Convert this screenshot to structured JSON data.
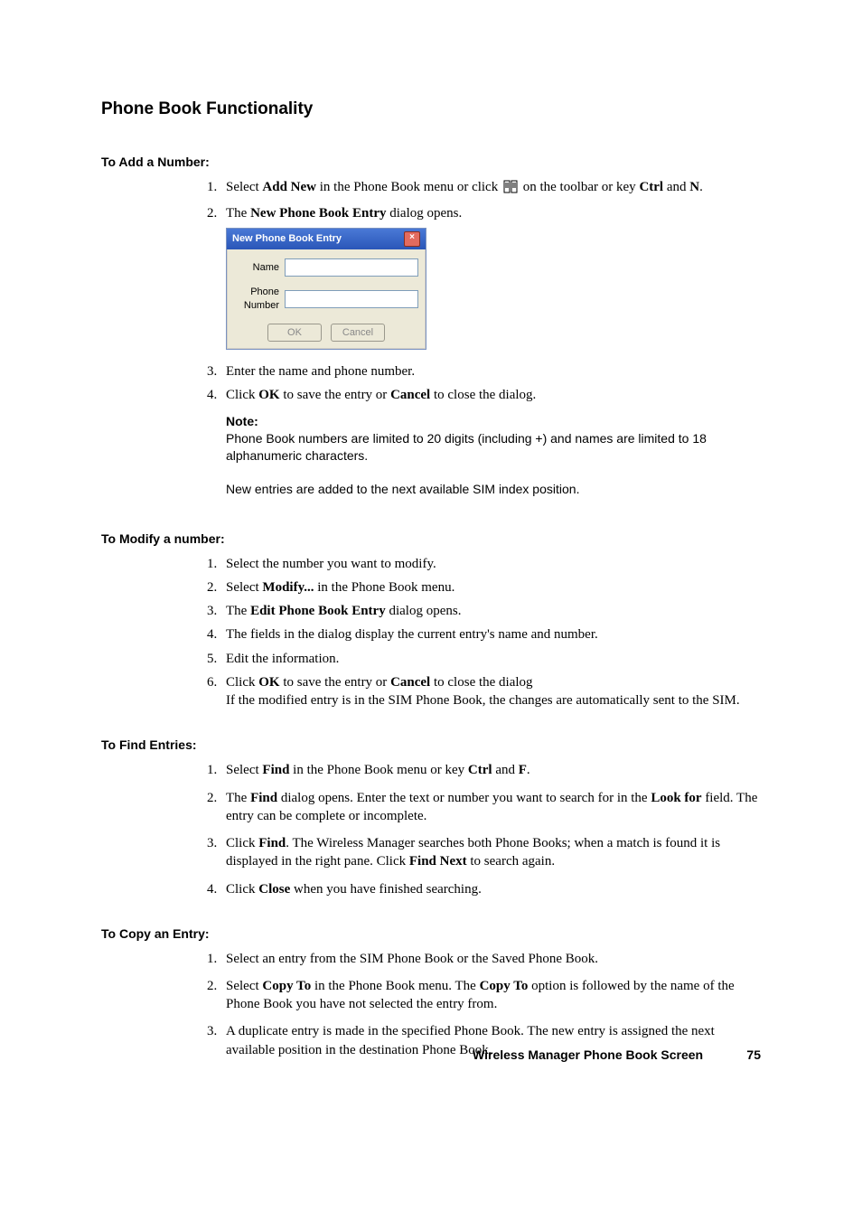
{
  "title": "Phone Book Functionality",
  "sections": {
    "add": {
      "heading": "To Add a Number:",
      "step1_pre": "Select ",
      "step1_b1": "Add New",
      "step1_mid": " in the Phone Book menu or click ",
      "step1_post": " on the toolbar or key ",
      "step1_b2": "Ctrl",
      "step1_and": " and ",
      "step1_b3": "N",
      "step1_end": ".",
      "step2_pre": "The ",
      "step2_b": "New Phone Book Entry",
      "step2_post": " dialog opens.",
      "dlg_title": "New Phone Book Entry",
      "dlg_name_label": "Name",
      "dlg_phone_label": "Phone Number",
      "dlg_ok": "OK",
      "dlg_cancel": "Cancel",
      "step3": "Enter the name and phone number.",
      "step4_pre": "Click ",
      "step4_b1": "OK",
      "step4_mid": " to save the entry or ",
      "step4_b2": "Cancel",
      "step4_post": " to close the dialog.",
      "note_label": "Note:",
      "note_body": "Phone Book numbers are limited to 20 digits (including +) and names are limited to 18 alphanumeric characters.",
      "note_follow": "New entries are added to the next available SIM index position."
    },
    "modify": {
      "heading": "To Modify a number:",
      "s1": "Select the number you want to modify.",
      "s2_pre": "Select ",
      "s2_b": "Modify...",
      "s2_post": " in the Phone Book menu.",
      "s3_pre": "The ",
      "s3_b": "Edit Phone Book Entry",
      "s3_post": " dialog opens.",
      "s4": "The fields in the dialog display the current entry's name and number.",
      "s5": "Edit the information.",
      "s6_pre": "Click ",
      "s6_b1": "OK",
      "s6_mid": " to save the entry or ",
      "s6_b2": "Cancel",
      "s6_post": " to close the dialog",
      "s6_line2": "If the modified entry is in the SIM Phone Book, the changes are automatically sent to the SIM."
    },
    "find": {
      "heading": "To Find Entries:",
      "s1_pre": "Select ",
      "s1_b1": "Find",
      "s1_mid": " in the Phone Book menu or key ",
      "s1_b2": "Ctrl",
      "s1_and": " and ",
      "s1_b3": "F",
      "s1_end": ".",
      "s2_pre": "The ",
      "s2_b1": "Find",
      "s2_mid": " dialog opens. Enter the text or number you want to search for in the ",
      "s2_b2": "Look for",
      "s2_post": " field. The entry can be complete or incomplete.",
      "s3_pre": "Click ",
      "s3_b1": "Find",
      "s3_mid": ". The Wireless Manager searches both Phone Books; when a match is found it is displayed in the right pane. Click ",
      "s3_b2": "Find Next",
      "s3_post": " to search again.",
      "s4_pre": "Click ",
      "s4_b": "Close",
      "s4_post": " when you have finished searching."
    },
    "copy": {
      "heading": "To Copy an Entry:",
      "s1": "Select an entry from the SIM Phone Book or the Saved Phone Book.",
      "s2_pre": "Select ",
      "s2_b1": "Copy To",
      "s2_mid": " in the Phone Book menu. The ",
      "s2_b2": "Copy To",
      "s2_post": " option is followed by the name of the Phone Book you have not selected the entry from.",
      "s3": "A duplicate entry is made in the specified Phone Book. The new entry is assigned the next available position in the destination Phone Book."
    }
  },
  "footer": {
    "text": "Wireless Manager Phone Book Screen",
    "page": "75"
  }
}
